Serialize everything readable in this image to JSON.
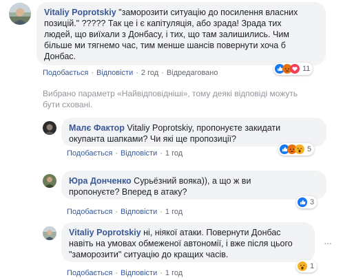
{
  "comments": [
    {
      "author": "Vitaliy Poprotskiy",
      "lines": [
        " \"заморозити ситуацію до посилення власних",
        "позицій.\" ????? Так це і є капітуляція, або зрада! Зрада тих",
        "людей, що виїхали з Донбасу, і тих, що там залишились. Чим",
        "більше ми тягнемо час, тим менше шансів повернути хоча б",
        "Донбас."
      ],
      "like": "Подобається",
      "reply": "Відповісти",
      "time": "2 год",
      "edited": "Відредаговано",
      "reaction_count": "11"
    },
    {
      "author": "Малє Фактор",
      "lines": [
        " Vitaliy Poprotskiy, пропонуєте закидати",
        "окупанта шапками? Чи які ще пропозиції?"
      ],
      "like": "Подобається",
      "reply": "Відповісти",
      "time": "1 год",
      "reaction_count": "5"
    },
    {
      "author": "Юра Донченко",
      "lines": [
        " Сурьёзний вояка)), а що ж ви",
        "пропонуєте? Вперед в атаку?"
      ],
      "like": "Подобається",
      "reply": "Відповісти",
      "time": "1 год",
      "reaction_count": "3"
    },
    {
      "author": "Vitaliy Poprotskiy",
      "lines": [
        " ні, ніякої атаки. Повернути Донбас",
        "навіть на умовах обмеженої автономії, і вже після цього",
        "\"заморозити\" ситуацію до кращих часів."
      ],
      "like": "Подобається",
      "reply": "Відповісти",
      "time": "1 год",
      "reaction_count": "1"
    }
  ],
  "notice": {
    "line1": "Вибрано параметр «Найвідповідніші», тому деякі відповіді можуть",
    "line2": "бути сховані."
  },
  "colors": {
    "link": "#385898",
    "bubble": "#f2f3f5",
    "meta": "#606770",
    "notice": "#90949c",
    "like_blue": "#1877f2",
    "love_red": "#f33e58",
    "angry_orange": "#e9710f",
    "wow_yellow": "#f7b125"
  }
}
